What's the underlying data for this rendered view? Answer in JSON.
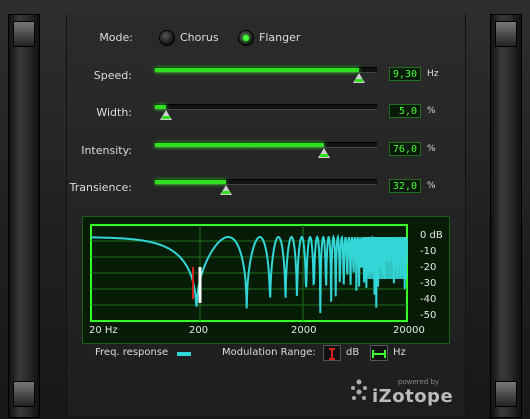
{
  "mode": {
    "label": "Mode:",
    "options": [
      {
        "label": "Chorus",
        "selected": false
      },
      {
        "label": "Flanger",
        "selected": true
      }
    ]
  },
  "sliders": [
    {
      "label": "Speed:",
      "value": "9,30",
      "unit": "Hz",
      "level": 0.92
    },
    {
      "label": "Width:",
      "value": "5,0",
      "unit": "%",
      "level": 0.05
    },
    {
      "label": "Intensity:",
      "value": "76,0",
      "unit": "%",
      "level": 0.76
    },
    {
      "label": "Transience:",
      "value": "32,0",
      "unit": "%",
      "level": 0.32
    }
  ],
  "scope": {
    "y_labels": [
      "0 dB",
      "-10",
      "-20",
      "-30",
      "-40",
      "-50"
    ],
    "x_labels": [
      "20 Hz",
      "200",
      "2000",
      "20000"
    ]
  },
  "footer": {
    "freq_response_label": "Freq. response",
    "mod_range_label": "Modulation Range:",
    "db_label": "dB",
    "hz_label": "Hz"
  },
  "branding": {
    "powered_by": "powered by",
    "name": "iZotope"
  },
  "colors": {
    "accent": "#40ff30",
    "curve": "#33d6d6",
    "scope_bg": "#071c07"
  }
}
